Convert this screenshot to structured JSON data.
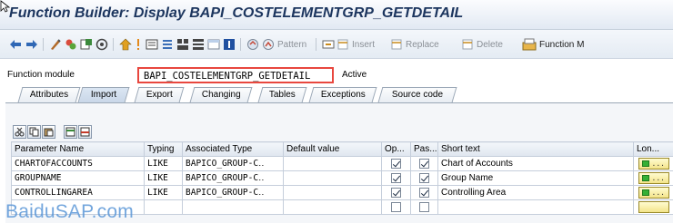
{
  "window": {
    "title": "Function Builder: Display BAPI_COSTELEMENTGRP_GETDETAIL"
  },
  "toolbar": {
    "nav_icons": [
      "back-arrow-icon",
      "forward-arrow-icon"
    ],
    "tool_icons": [
      "other-object-icon",
      "change-display-icon",
      "active-inactive-icon",
      "check-icon",
      "activate-icon",
      "where-used-icon",
      "display-object-list-icon",
      "test-icon",
      "navigation-window-icon",
      "info-icon",
      "enhance-icon",
      "modification-icon"
    ],
    "pattern_label": "Pattern",
    "insert_label": "Insert",
    "replace_label": "Replace",
    "delete_label": "Delete",
    "function_module_label": "Function M"
  },
  "header": {
    "function_module_label": "Function module",
    "function_module_value": "BAPI_COSTELEMENTGRP_GETDETAIL",
    "status": "Active"
  },
  "tabs": [
    {
      "label": "Attributes",
      "active": false
    },
    {
      "label": "Import",
      "active": true
    },
    {
      "label": "Export",
      "active": false
    },
    {
      "label": "Changing",
      "active": false
    },
    {
      "label": "Tables",
      "active": false
    },
    {
      "label": "Exceptions",
      "active": false
    },
    {
      "label": "Source code",
      "active": false
    }
  ],
  "grid": {
    "tool_icons": [
      "cut-icon",
      "copy-icon",
      "paste-icon",
      "insert-row-icon",
      "delete-row-icon"
    ],
    "columns": [
      "Parameter Name",
      "Typing",
      "Associated Type",
      "Default value",
      "Op...",
      "Pas...",
      "Short text",
      "Lon..."
    ],
    "rows": [
      {
        "name": "CHARTOFACCOUNTS",
        "typing": "LIKE",
        "type": "BAPICO_GROUP-C‥",
        "default": "",
        "optional": true,
        "pass_value": true,
        "short_text": "Chart of Accounts",
        "long_text": true
      },
      {
        "name": "GROUPNAME",
        "typing": "LIKE",
        "type": "BAPICO_GROUP-C‥",
        "default": "",
        "optional": true,
        "pass_value": true,
        "short_text": "Group Name",
        "long_text": true
      },
      {
        "name": "CONTROLLINGAREA",
        "typing": "LIKE",
        "type": "BAPICO_GROUP-C‥",
        "default": "",
        "optional": true,
        "pass_value": true,
        "short_text": "Controlling Area",
        "long_text": true
      },
      {
        "name": "",
        "typing": "",
        "type": "",
        "default": "",
        "optional": false,
        "pass_value": false,
        "short_text": "",
        "long_text": false
      }
    ]
  },
  "watermark": "BaiduSAP.com",
  "colors": {
    "title": "#1c355e",
    "highlight_border": "#e8473e",
    "watermark": "#5a96d7"
  }
}
